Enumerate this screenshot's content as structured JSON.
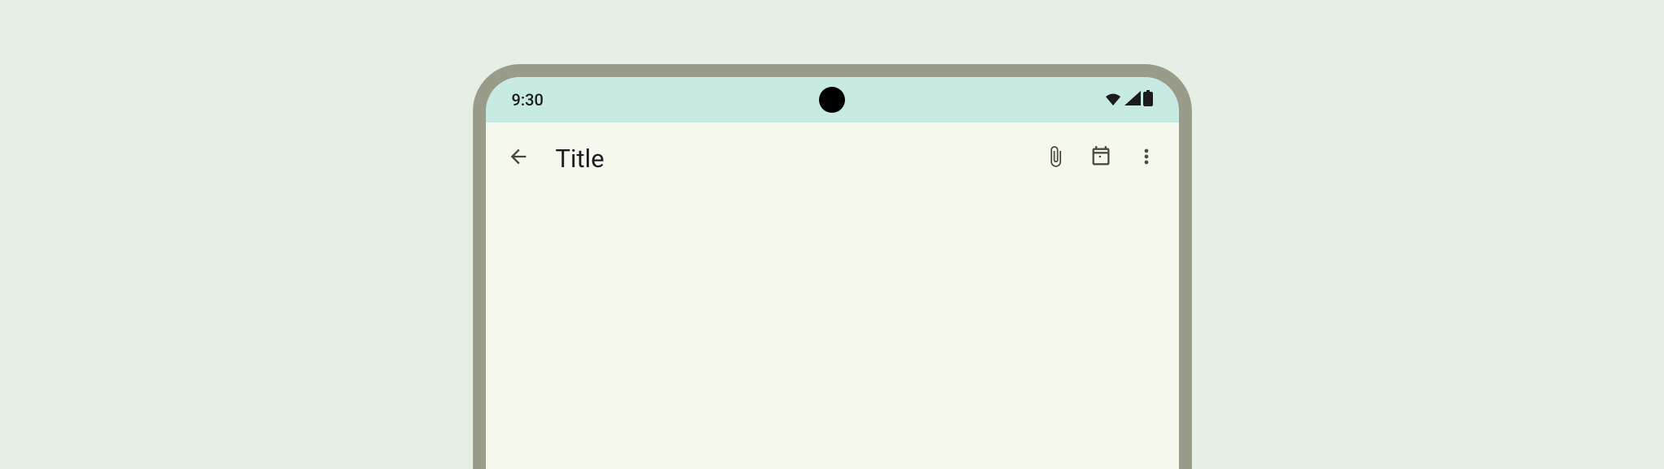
{
  "status_bar": {
    "time": "9:30",
    "wifi_icon": "wifi",
    "signal_icon": "cellular",
    "battery_icon": "battery"
  },
  "app_bar": {
    "back_icon": "arrow-back",
    "title": "Title",
    "actions": {
      "attach_icon": "attachment",
      "calendar_icon": "calendar",
      "more_icon": "more-vert"
    }
  }
}
